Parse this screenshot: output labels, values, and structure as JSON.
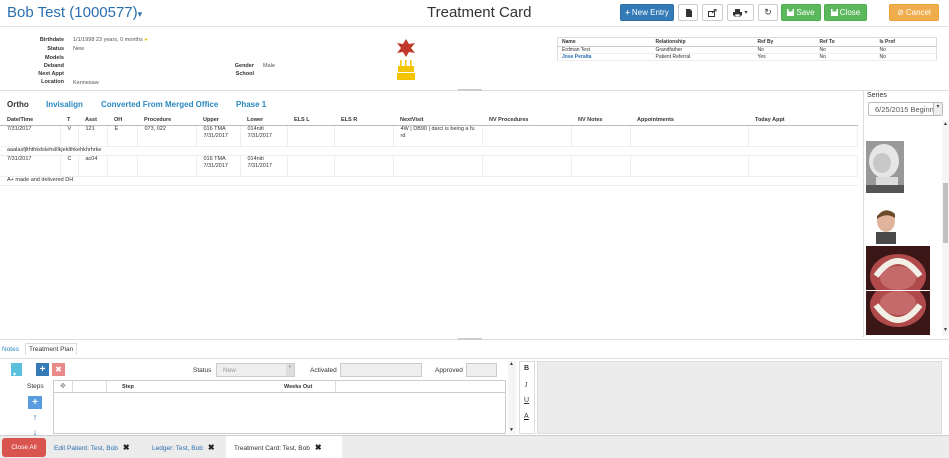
{
  "header": {
    "patient_name": "Bob Test (1000577)",
    "page_title": "Treatment Card",
    "buttons": {
      "new_entry": "New Entry",
      "save": "Save",
      "close": "Close",
      "cancel": "Cancel"
    }
  },
  "patient": {
    "birthdate_label": "Birthdate",
    "birthdate": "1/1/1998 23 years, 0 months",
    "status_label": "Status",
    "status": "New",
    "models_label": "Models",
    "models": "",
    "deband_label": "Deband",
    "deband": "",
    "next_appt_label": "Next Appt",
    "next_appt": "",
    "location_label": "Location",
    "location": "Kennesaw",
    "gender_label": "Gender",
    "gender": "Male",
    "school_label": "School",
    "school": ""
  },
  "relationships": {
    "headers": [
      "Name",
      "Relationship",
      "Ref By",
      "Ref To",
      "Is Prof"
    ],
    "rows": [
      [
        "Erdman Test",
        "Grandfather",
        "No",
        "No",
        "No"
      ],
      [
        "Jose Peralta",
        "Patient Referral",
        "Yes",
        "No",
        "No"
      ]
    ]
  },
  "tabs": [
    "Ortho",
    "Invisalign",
    "Converted From Merged Office",
    "Phase 1"
  ],
  "entries": {
    "headers": [
      "Date/Time",
      "T",
      "Asst",
      "OH",
      "Procedure",
      "Upper",
      "Lower",
      "ELS L",
      "ELS R",
      "NextVisit",
      "NV Procedures",
      "NV Notes",
      "Appointments",
      "Today Appt"
    ],
    "rows": [
      {
        "date": "7/31/2017",
        "t": "V",
        "asst": "121",
        "oh": "E",
        "procedure": "073, 022",
        "upper1": "016 TMA",
        "upper2": "7/31/2017",
        "lower1": "014niti",
        "lower2": "7/31/2017",
        "next1": "4W | DB90 | darci is being a fu",
        "next2": "rd",
        "note": "aaalasfjlththkdslehslllkjeklthkehkhrhrke"
      },
      {
        "date": "7/31/2017",
        "t": "C",
        "asst": "ac04",
        "oh": "",
        "procedure": "",
        "upper1": "016 TMA",
        "upper2": "7/31/2017",
        "lower1": "014niti",
        "lower2": "7/31/2017",
        "next1": "",
        "next2": "",
        "note": "A+ made and delivered DH"
      }
    ]
  },
  "series": {
    "label": "Series",
    "selected": "6/25/2015 Beginn"
  },
  "bottom": {
    "tabs": [
      "Notes",
      "Treatment Plan"
    ],
    "status_label": "Status",
    "status_value": "New",
    "activated_label": "Activated",
    "approved_label": "Approved",
    "steps_label": "Steps",
    "step_header": "Step",
    "weeks_out_header": "Weeks Out"
  },
  "footer": {
    "close_all": "Close All",
    "tabs": [
      "Edit Patient: Test, Bob",
      "Ledger: Test, Bob",
      "Treatment Card: Test, Bob"
    ]
  },
  "colors": {
    "link_blue": "#2a6fb0",
    "primary": "#337ab7",
    "success": "#5cb85c",
    "warning": "#f0ad4e",
    "danger": "#d9534f"
  }
}
